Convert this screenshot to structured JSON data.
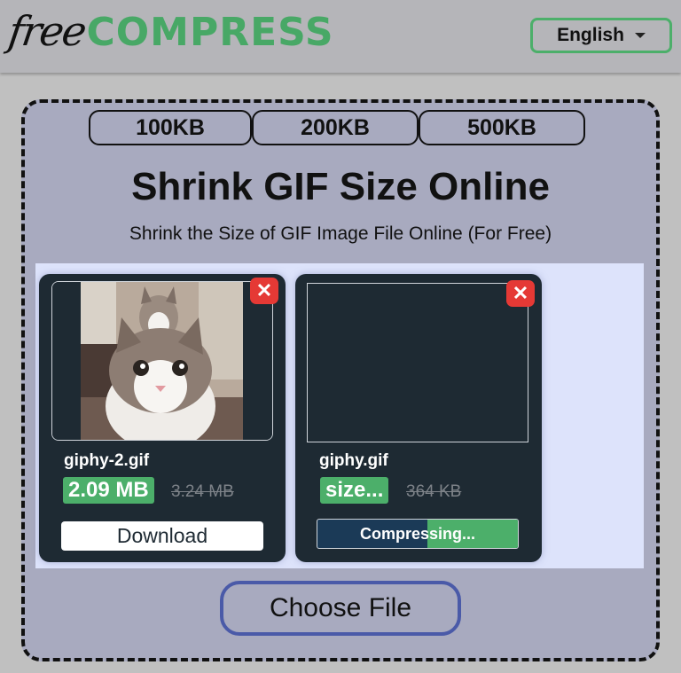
{
  "header": {
    "logo_free": "free",
    "logo_compress": "COMPRESS",
    "language": "English",
    "language_icon": "caret-down-icon"
  },
  "size_presets": [
    "100KB",
    "200KB",
    "500KB"
  ],
  "main": {
    "title": "Shrink GIF Size Online",
    "subtitle": "Shrink the Size of GIF Image File Online (For Free)"
  },
  "files": [
    {
      "name": "giphy-2.gif",
      "new_size": "2.09 MB",
      "old_size": "3.24 MB",
      "status": "done",
      "action_label": "Download",
      "preview": "cat image thumbnail"
    },
    {
      "name": "giphy.gif",
      "new_size": "size...",
      "old_size": "364 KB",
      "status": "compressing",
      "progress_label": "Compressing...",
      "progress_percent": 45
    }
  ],
  "choose_file_label": "Choose File",
  "colors": {
    "brand_green": "#48a866",
    "close_red": "#e53935",
    "card_bg": "#1e2a33",
    "choose_border": "#4a5aa8"
  }
}
